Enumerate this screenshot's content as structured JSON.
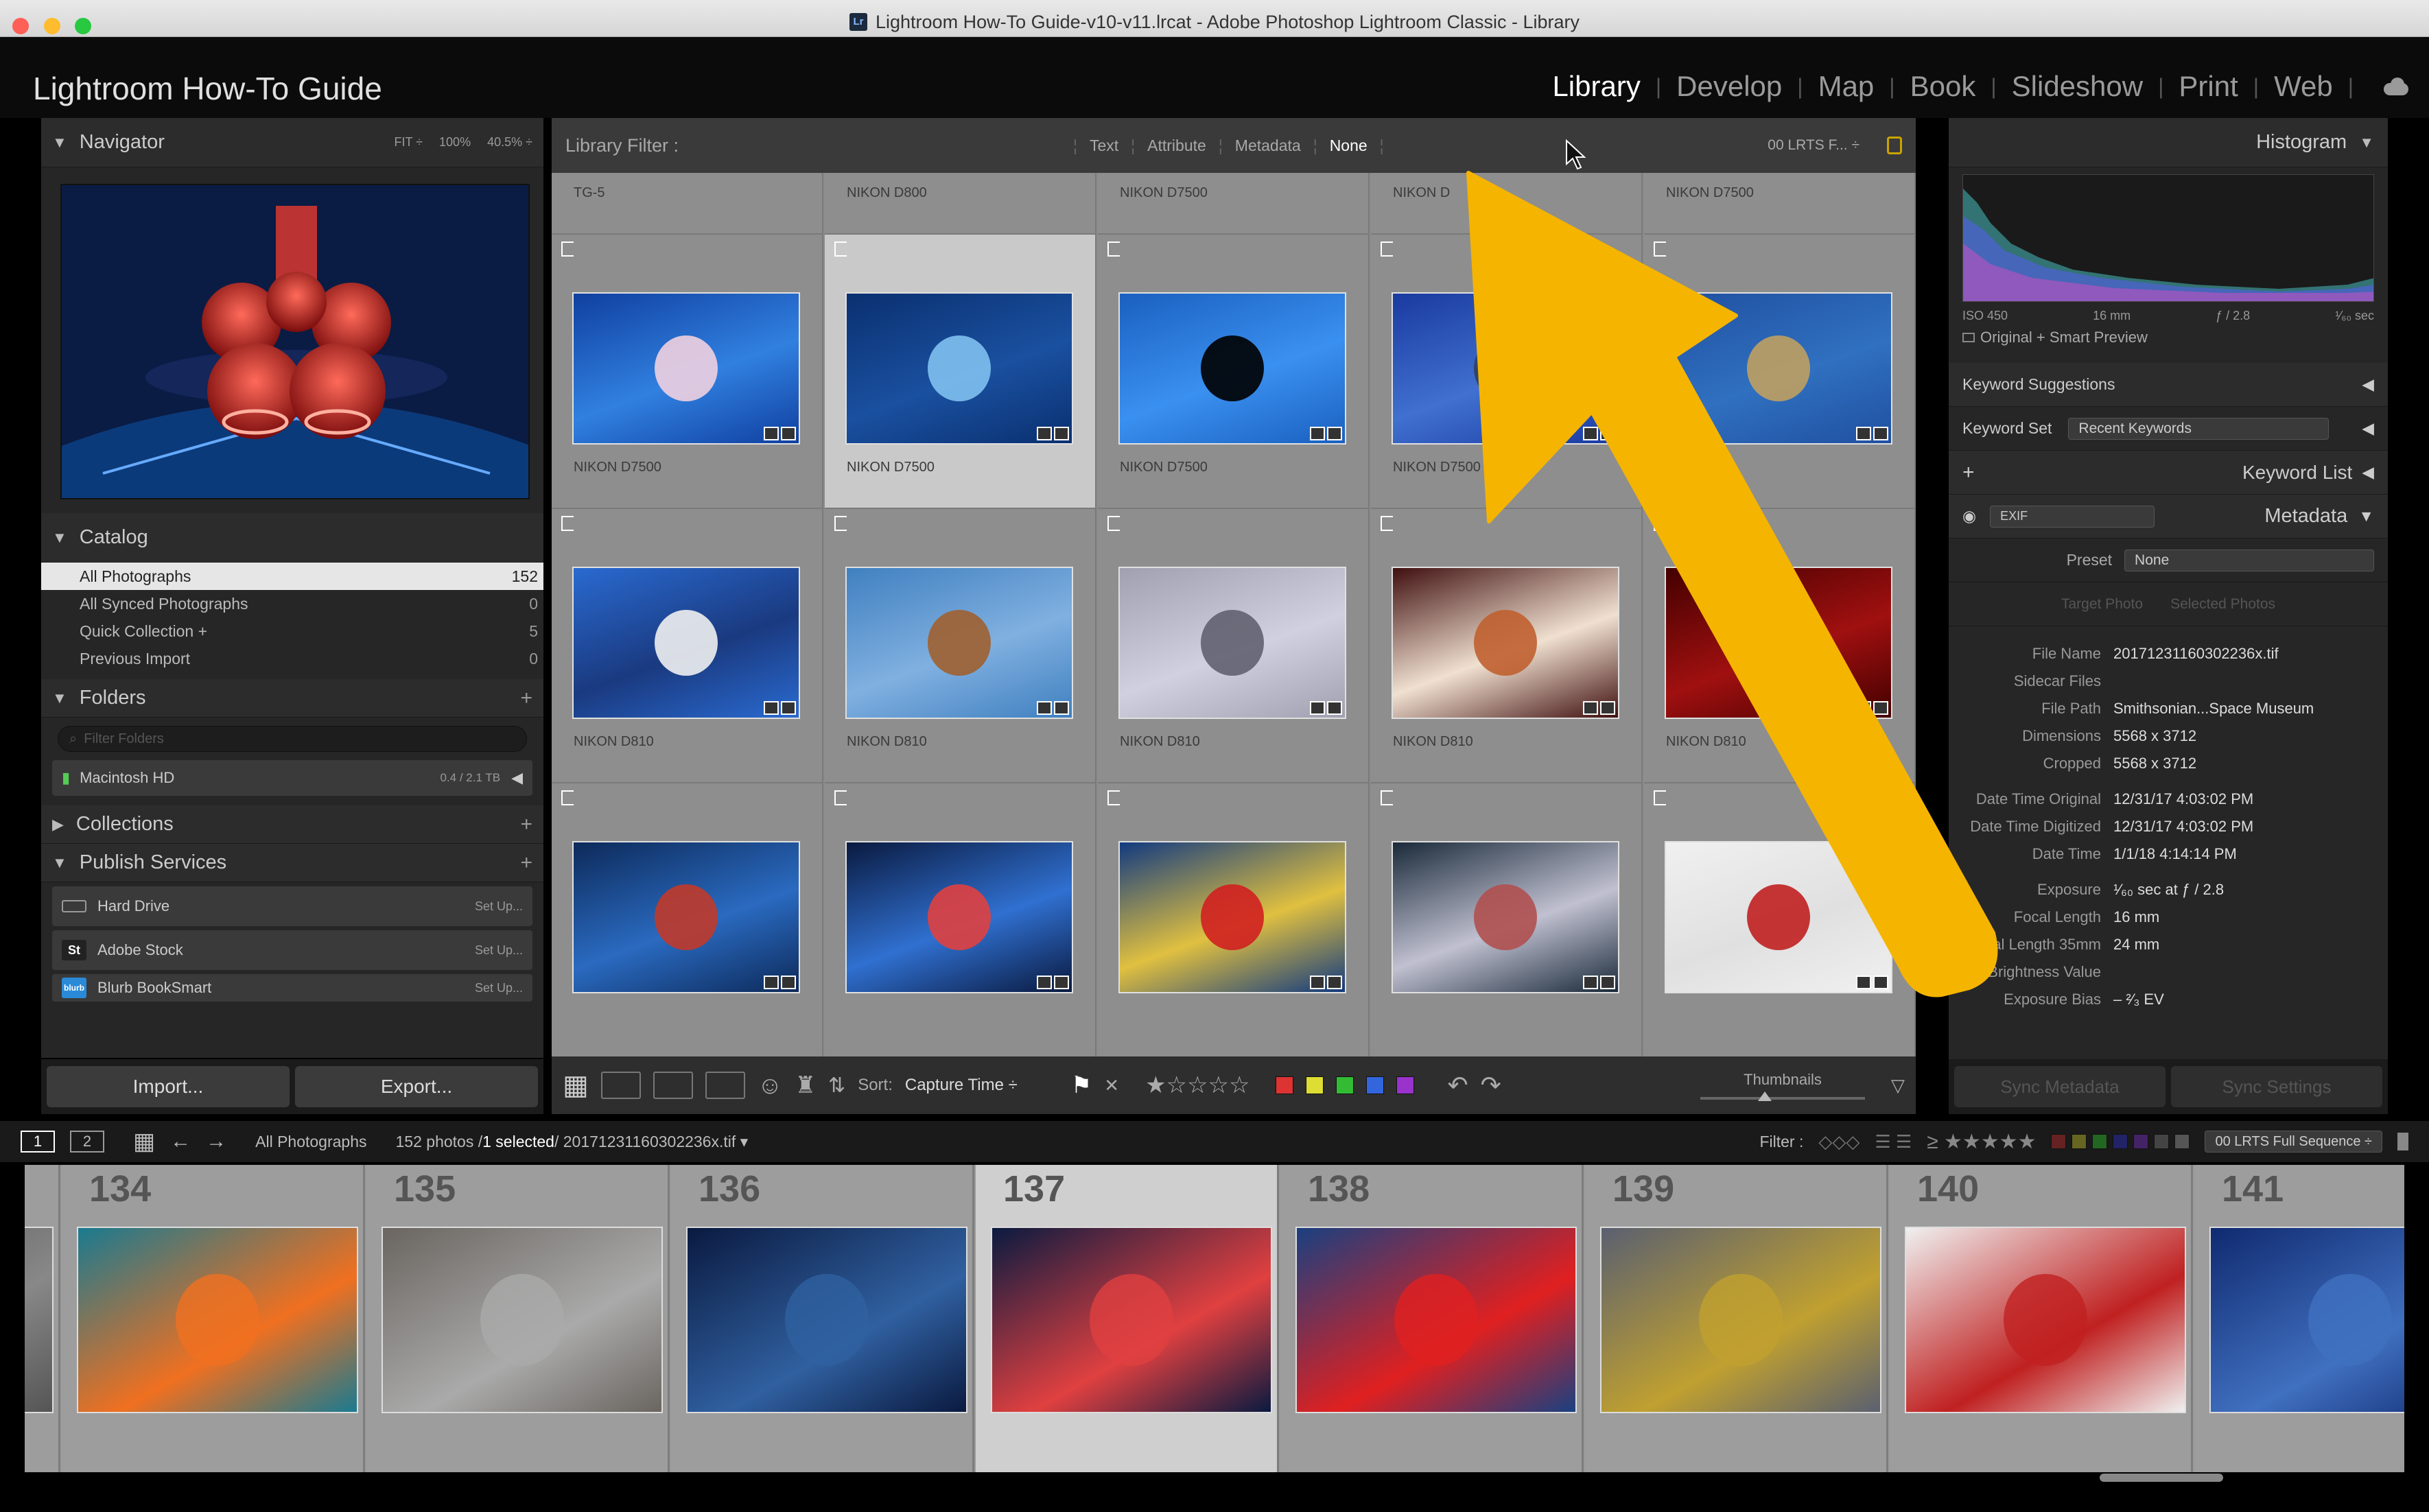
{
  "window": {
    "title": "Lightroom How-To Guide-v10-v11.lrcat - Adobe Photoshop Lightroom Classic - Library"
  },
  "identity": {
    "brand": "Lightroom How-To Guide"
  },
  "modules": [
    "Library",
    "Develop",
    "Map",
    "Book",
    "Slideshow",
    "Print",
    "Web"
  ],
  "navigator": {
    "title": "Navigator",
    "zoom": [
      "FIT ÷",
      "100%",
      "40.5% ÷"
    ]
  },
  "catalog": {
    "title": "Catalog",
    "items": [
      {
        "label": "All Photographs",
        "count": "152"
      },
      {
        "label": "All Synced Photographs",
        "count": "0"
      },
      {
        "label": "Quick Collection +",
        "count": "5"
      },
      {
        "label": "Previous Import",
        "count": "0"
      }
    ]
  },
  "folders": {
    "title": "Folders",
    "filter_placeholder": "Filter Folders",
    "volume": "Macintosh HD",
    "volume_size": "0.4 / 2.1 TB"
  },
  "collections": {
    "title": "Collections"
  },
  "publish": {
    "title": "Publish Services",
    "items": [
      {
        "label": "Hard Drive",
        "action": "Set Up..."
      },
      {
        "label": "Adobe Stock",
        "action": "Set Up..."
      },
      {
        "label": "Blurb BookSmart",
        "action": "Set Up..."
      }
    ]
  },
  "buttons": {
    "import": "Import...",
    "export": "Export..."
  },
  "library_filter": {
    "label": "Library Filter :",
    "options": [
      "Text",
      "Attribute",
      "Metadata",
      "None"
    ],
    "preset": "00 LRTS F... ÷"
  },
  "grid": {
    "top_row": [
      "TG-5",
      "NIKON D800",
      "NIKON D7500",
      "NIKON D",
      "NIKON D7500"
    ],
    "rows": [
      [
        "NIKON D7500",
        "NIKON D7500",
        "NIKON D7500",
        "NIKON D7500",
        "D7500"
      ],
      [
        "NIKON D810",
        "NIKON D810",
        "NIKON D810",
        "NIKON D810",
        "NIKON D810"
      ],
      [
        "",
        "",
        "",
        "",
        ""
      ]
    ]
  },
  "toolbar": {
    "sort_label": "Sort:",
    "sort_value": "Capture Time ÷",
    "thumbnails": "Thumbnails"
  },
  "histogram": {
    "title": "Histogram",
    "iso": "ISO 450",
    "focal": "16 mm",
    "aperture": "ƒ / 2.8",
    "shutter": "¹⁄₆₀ sec",
    "preview": "Original + Smart Preview"
  },
  "keywording": {
    "suggestions": "Keyword Suggestions",
    "set_label": "Keyword Set",
    "set_value": "Recent Keywords",
    "list": "Keyword List"
  },
  "metadata": {
    "title": "Metadata",
    "view": "EXIF",
    "preset_label": "Preset",
    "preset_value": "None",
    "target": "Target Photo",
    "selected": "Selected Photos",
    "fields": [
      {
        "k": "File Name",
        "v": "20171231160302236x.tif"
      },
      {
        "k": "Sidecar Files",
        "v": ""
      },
      {
        "k": "File Path",
        "v": "Smithsonian...Space Museum"
      },
      {
        "k": "Dimensions",
        "v": "5568 x 3712"
      },
      {
        "k": "Cropped",
        "v": "5568 x 3712"
      },
      {
        "k": "Date Time Original",
        "v": "12/31/17 4:03:02 PM"
      },
      {
        "k": "Date Time Digitized",
        "v": "12/31/17 4:03:02 PM"
      },
      {
        "k": "Date Time",
        "v": "1/1/18 4:14:14 PM"
      },
      {
        "k": "Exposure",
        "v": "¹⁄₆₀ sec at ƒ / 2.8"
      },
      {
        "k": "Focal Length",
        "v": "16 mm"
      },
      {
        "k": "cal Length 35mm",
        "v": "24 mm"
      },
      {
        "k": "Brightness Value",
        "v": ""
      },
      {
        "k": "Exposure Bias",
        "v": "– ²⁄₃ EV"
      }
    ]
  },
  "sync": {
    "metadata": "Sync Metadata",
    "settings": "Sync Settings"
  },
  "filmstrip_bar": {
    "pages": [
      "1",
      "2"
    ],
    "source": "All Photographs",
    "status_count": "152 photos /",
    "status_selected": "1 selected",
    "status_file": "/ 20171231160302236x.tif ▾",
    "filter_label": "Filter :",
    "filter_preset": "00 LRTS Full Sequence ÷"
  },
  "filmstrip": {
    "numbers": [
      "",
      "134",
      "135",
      "136",
      "137",
      "138",
      "139",
      "140",
      "141"
    ]
  },
  "colors": {
    "accent_arrow": "#f5b400",
    "selected_cell": "#c9c9c9",
    "panel": "#262626"
  }
}
